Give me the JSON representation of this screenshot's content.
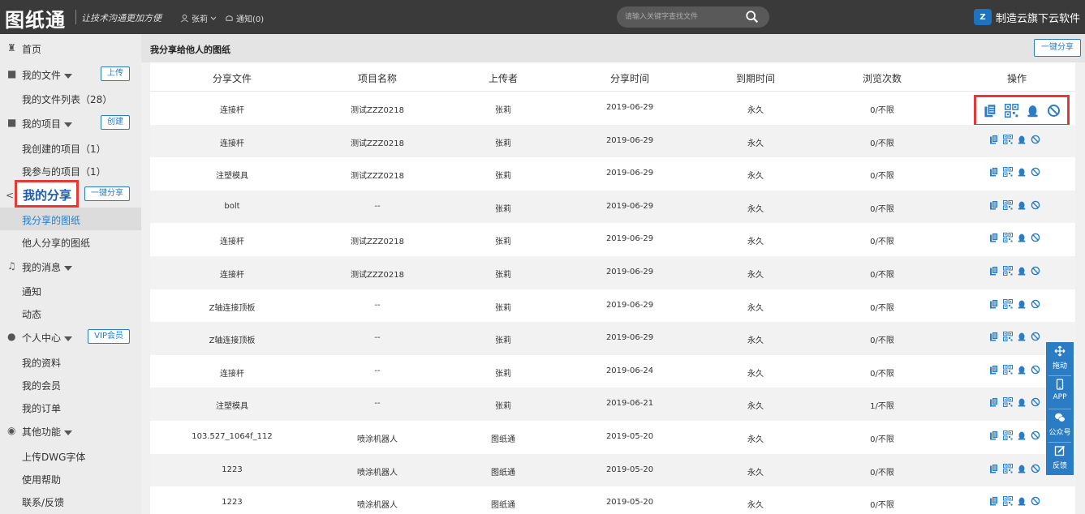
{
  "topbar": {
    "logo": "图纸通",
    "slogan": "让技术沟通更加方便",
    "user": "张莉",
    "notify": "通知(0)",
    "search_placeholder": "请输入关键字查找文件",
    "brand": "制造云旗下云软件"
  },
  "sidebar": {
    "home": "首页",
    "my_files": "我的文件",
    "upload": "上传",
    "file_list": "我的文件列表（28）",
    "my_projects": "我的项目",
    "create": "创建",
    "created_projects": "我创建的项目（1）",
    "joined_projects": "我参与的项目（1）",
    "my_share": "我的分享",
    "one_key_share": "一键分享",
    "shared_by_me": "我分享的图纸",
    "shared_by_others": "他人分享的图纸",
    "my_messages": "我的消息",
    "notice": "通知",
    "activity": "动态",
    "personal": "个人中心",
    "vip": "VIP会员",
    "my_info": "我的资料",
    "my_member": "我的会员",
    "my_orders": "我的订单",
    "other": "其他功能",
    "upload_font": "上传DWG字体",
    "help": "使用帮助",
    "contact": "联系/反馈"
  },
  "main": {
    "title": "我分享给他人的图纸",
    "one_key_share": "一键分享",
    "columns": [
      "分享文件",
      "项目名称",
      "上传者",
      "分享时间",
      "到期时间",
      "浏览次数",
      "操作"
    ],
    "rows": [
      [
        "连接杆",
        "测试ZZZ0218",
        "张莉",
        "2019-06-29",
        "永久",
        "0/不限"
      ],
      [
        "连接杆",
        "测试ZZZ0218",
        "张莉",
        "2019-06-29",
        "永久",
        "0/不限"
      ],
      [
        "注塑模具",
        "测试ZZZ0218",
        "张莉",
        "2019-06-29",
        "永久",
        "0/不限"
      ],
      [
        "bolt",
        "--",
        "张莉",
        "2019-06-29",
        "永久",
        "0/不限"
      ],
      [
        "连接杆",
        "测试ZZZ0218",
        "张莉",
        "2019-06-29",
        "永久",
        "0/不限"
      ],
      [
        "连接杆",
        "测试ZZZ0218",
        "张莉",
        "2019-06-29",
        "永久",
        "0/不限"
      ],
      [
        "Z轴连接顶板",
        "--",
        "张莉",
        "2019-06-29",
        "永久",
        "0/不限"
      ],
      [
        "Z轴连接顶板",
        "--",
        "张莉",
        "2019-06-29",
        "永久",
        "0/不限"
      ],
      [
        "连接杆",
        "--",
        "张莉",
        "2019-06-24",
        "永久",
        "0/不限"
      ],
      [
        "注塑模具",
        "--",
        "张莉",
        "2019-06-21",
        "永久",
        "1/不限"
      ],
      [
        "103.527_1064f_112",
        "喷涂机器人",
        "图纸通",
        "2019-05-20",
        "永久",
        "0/不限"
      ],
      [
        "1223",
        "喷涂机器人",
        "图纸通",
        "2019-05-20",
        "永久",
        "0/不限"
      ],
      [
        "1223",
        "喷涂机器人",
        "图纸通",
        "2019-05-20",
        "永久",
        "0/不限"
      ]
    ]
  },
  "float_panel": {
    "drag": "拖动",
    "app": "APP",
    "wechat": "公众号",
    "feedback": "反馈"
  },
  "colors": {
    "accent": "#2a7dc4",
    "highlight": "#e53935",
    "topbar": "#3a3a3a"
  }
}
